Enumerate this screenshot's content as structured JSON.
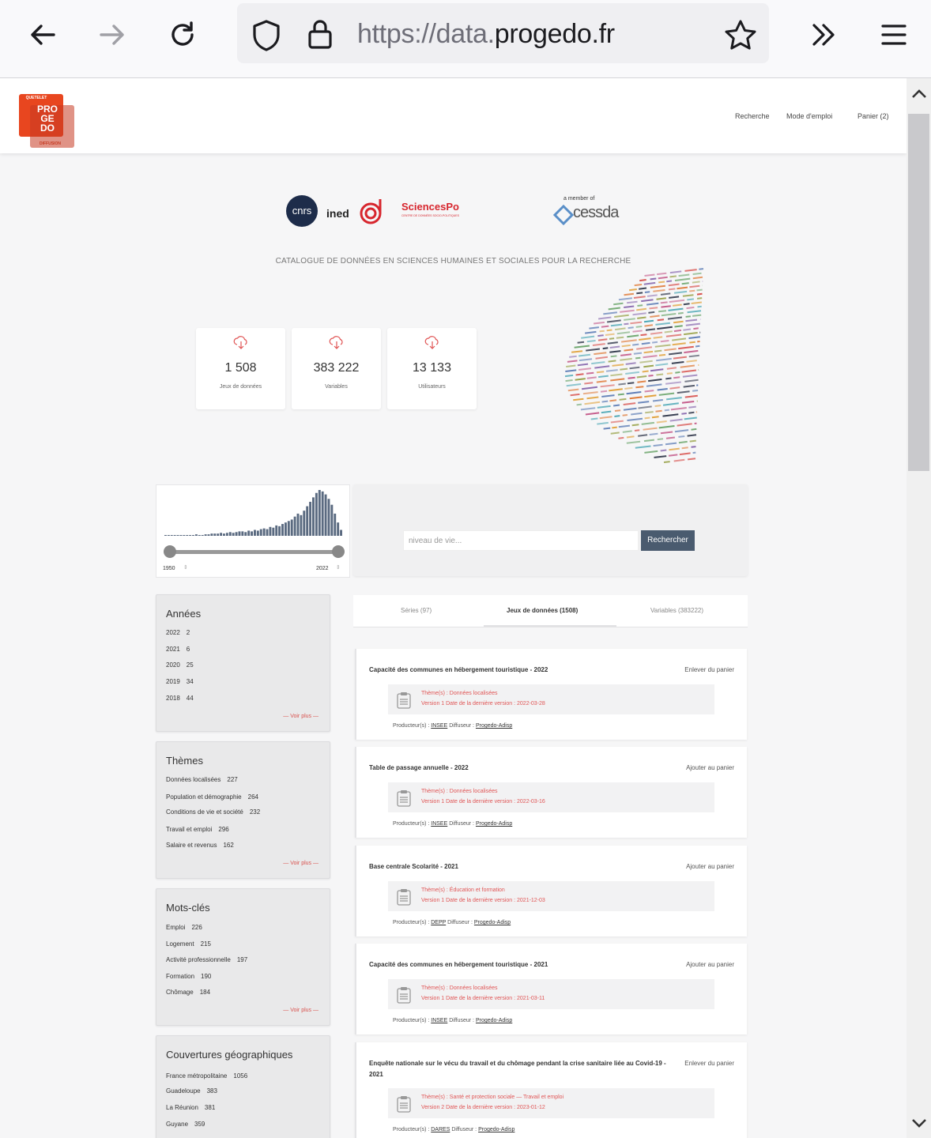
{
  "browser": {
    "url_prefix": "https://data.",
    "url_domain": "progedo.fr"
  },
  "header": {
    "logo_lines": [
      "PRO",
      "GE",
      "DO"
    ],
    "logo_top": "QUETELET",
    "logo_bottom": "DIFFUSION",
    "nav": [
      "Recherche",
      "Mode d'emploi",
      "Panier (2)"
    ]
  },
  "partners": {
    "cnrs": "cnrs",
    "ined": "ined",
    "sciencespo": "SciencesPo",
    "sciencespo_sub": "CENTRE DE DONNÉES SOCIO-POLITIQUES",
    "member_of": "a member of",
    "cessda": "cessda"
  },
  "tagline": "CATALOGUE DE DONNÉES EN SCIENCES HUMAINES ET SOCIALES POUR LA RECHERCHE",
  "stats": [
    {
      "value": "1 508",
      "label": "Jeux de données"
    },
    {
      "value": "383 222",
      "label": "Variables"
    },
    {
      "value": "13 133",
      "label": "Utilisateurs"
    }
  ],
  "histogram": {
    "year_from": "1950",
    "year_to": "2022",
    "bars": [
      1,
      1,
      1,
      1,
      1,
      1,
      1,
      1,
      1,
      1,
      2,
      1,
      1,
      2,
      2,
      3,
      3,
      3,
      4,
      3,
      4,
      5,
      4,
      5,
      6,
      6,
      5,
      7,
      6,
      8,
      7,
      9,
      10,
      9,
      12,
      11,
      14,
      13,
      16,
      18,
      20,
      22,
      26,
      30,
      28,
      34,
      40,
      46,
      52,
      58,
      62,
      60,
      56,
      50,
      42,
      30,
      18,
      8
    ]
  },
  "search": {
    "placeholder": "niveau de vie...",
    "button": "Rechercher"
  },
  "facets": [
    {
      "title": "Années",
      "rows": [
        [
          "2022",
          "2"
        ],
        [
          "2021",
          "6"
        ],
        [
          "2020",
          "25"
        ],
        [
          "2019",
          "34"
        ],
        [
          "2018",
          "44"
        ]
      ],
      "more": "— Voir plus —"
    },
    {
      "title": "Thèmes",
      "rows": [
        [
          "Données localisées",
          "227"
        ],
        [
          "Population et démographie",
          "264"
        ],
        [
          "Conditions de vie et société",
          "232"
        ],
        [
          "Travail et emploi",
          "296"
        ],
        [
          "Salaire et revenus",
          "162"
        ]
      ],
      "more": "— Voir plus —"
    },
    {
      "title": "Mots-clés",
      "rows": [
        [
          "Emploi",
          "226"
        ],
        [
          "Logement",
          "215"
        ],
        [
          "Activité professionnelle",
          "197"
        ],
        [
          "Formation",
          "190"
        ],
        [
          "Chômage",
          "184"
        ]
      ],
      "more": "— Voir plus —"
    },
    {
      "title": "Couvertures géographiques",
      "rows": [
        [
          "France métropolitaine",
          "1056"
        ],
        [
          "Guadeloupe",
          "383"
        ],
        [
          "La Réunion",
          "381"
        ],
        [
          "Guyane",
          "359"
        ]
      ],
      "more": ""
    }
  ],
  "tabs": [
    {
      "label": "Séries (97)"
    },
    {
      "label": "Jeux de données (1508)"
    },
    {
      "label": "Variables (383222)"
    }
  ],
  "results": [
    {
      "title": "Capacité des communes en hébergement touristique - 2022",
      "action": "Enlever du panier",
      "theme": "Thème(s) : Données localisées",
      "version": "Version 1 Date de la dernière version : 2022-03-28",
      "producer": "INSEE",
      "diffuser": "Progedo-Adisp"
    },
    {
      "title": "Table de passage annuelle - 2022",
      "action": "Ajouter au panier",
      "theme": "Thème(s) : Données localisées",
      "version": "Version 1 Date de la dernière version : 2022-03-16",
      "producer": "INSEE",
      "diffuser": "Progedo-Adisp"
    },
    {
      "title": "Base centrale Scolarité - 2021",
      "action": "Ajouter au panier",
      "theme": "Thème(s) : Éducation et formation",
      "version": "Version 1 Date de la dernière version : 2021-12-03",
      "producer": "DEPP",
      "diffuser": "Progedo-Adisp"
    },
    {
      "title": "Capacité des communes en hébergement touristique - 2021",
      "action": "Ajouter au panier",
      "theme": "Thème(s) : Données localisées",
      "version": "Version 1 Date de la dernière version : 2021-03-11",
      "producer": "INSEE",
      "diffuser": "Progedo-Adisp"
    },
    {
      "title": "Enquête nationale sur le vécu du travail et du chômage pendant la crise sanitaire liée au Covid-19 - 2021",
      "action": "Enlever du panier",
      "theme": "Thème(s) : Santé et protection sociale — Travail et emploi",
      "version": "Version 2 Date de la dernière version : 2023-01-12",
      "producer": "DARES",
      "diffuser": "Progedo-Adisp"
    }
  ],
  "labels": {
    "producer": "Producteur(s) :",
    "diffuser": "Diffuseur :"
  },
  "colors": {
    "accent_red": "#e05555",
    "button_dark": "#4a5b6f"
  }
}
